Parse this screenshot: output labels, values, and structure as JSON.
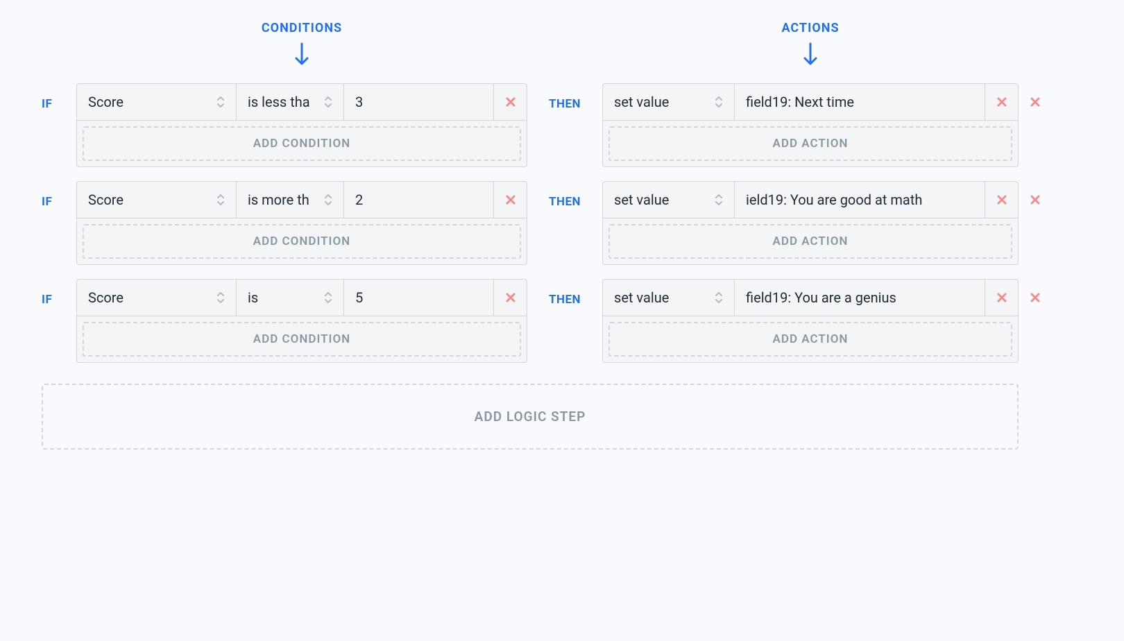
{
  "headers": {
    "conditions": "CONDITIONS",
    "actions": "ACTIONS"
  },
  "keywords": {
    "if": "IF",
    "then": "THEN"
  },
  "labels": {
    "add_condition": "ADD CONDITION",
    "add_action": "ADD ACTION",
    "add_logic_step": "ADD LOGIC STEP"
  },
  "rules": [
    {
      "condition": {
        "field": "Score",
        "operator": "is less tha",
        "value": "3"
      },
      "action": {
        "type": "set value",
        "target": "field19: Next time"
      }
    },
    {
      "condition": {
        "field": "Score",
        "operator": "is more th",
        "value": "2"
      },
      "action": {
        "type": "set value",
        "target": "ield19: You are good at math"
      }
    },
    {
      "condition": {
        "field": "Score",
        "operator": "is",
        "value": "5"
      },
      "action": {
        "type": "set value",
        "target": "field19: You are a genius"
      }
    }
  ]
}
